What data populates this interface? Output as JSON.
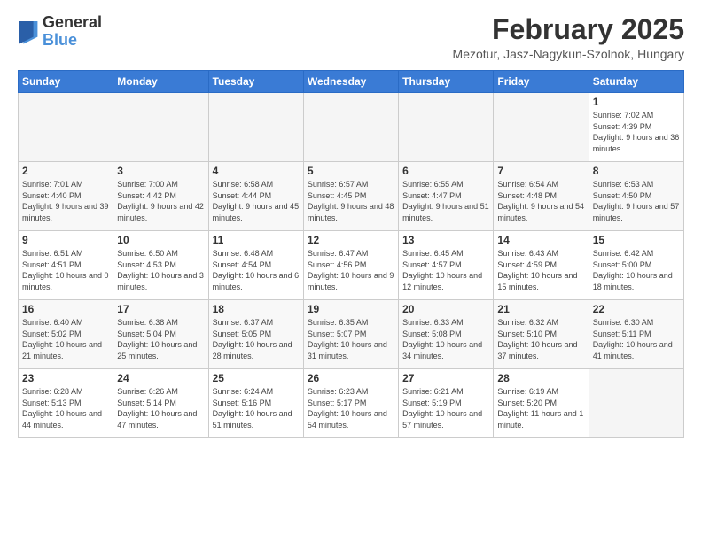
{
  "logo": {
    "general": "General",
    "blue": "Blue"
  },
  "title": "February 2025",
  "location": "Mezotur, Jasz-Nagykun-Szolnok, Hungary",
  "days_of_week": [
    "Sunday",
    "Monday",
    "Tuesday",
    "Wednesday",
    "Thursday",
    "Friday",
    "Saturday"
  ],
  "weeks": [
    [
      {
        "day": "",
        "info": ""
      },
      {
        "day": "",
        "info": ""
      },
      {
        "day": "",
        "info": ""
      },
      {
        "day": "",
        "info": ""
      },
      {
        "day": "",
        "info": ""
      },
      {
        "day": "",
        "info": ""
      },
      {
        "day": "1",
        "info": "Sunrise: 7:02 AM\nSunset: 4:39 PM\nDaylight: 9 hours and 36 minutes."
      }
    ],
    [
      {
        "day": "2",
        "info": "Sunrise: 7:01 AM\nSunset: 4:40 PM\nDaylight: 9 hours and 39 minutes."
      },
      {
        "day": "3",
        "info": "Sunrise: 7:00 AM\nSunset: 4:42 PM\nDaylight: 9 hours and 42 minutes."
      },
      {
        "day": "4",
        "info": "Sunrise: 6:58 AM\nSunset: 4:44 PM\nDaylight: 9 hours and 45 minutes."
      },
      {
        "day": "5",
        "info": "Sunrise: 6:57 AM\nSunset: 4:45 PM\nDaylight: 9 hours and 48 minutes."
      },
      {
        "day": "6",
        "info": "Sunrise: 6:55 AM\nSunset: 4:47 PM\nDaylight: 9 hours and 51 minutes."
      },
      {
        "day": "7",
        "info": "Sunrise: 6:54 AM\nSunset: 4:48 PM\nDaylight: 9 hours and 54 minutes."
      },
      {
        "day": "8",
        "info": "Sunrise: 6:53 AM\nSunset: 4:50 PM\nDaylight: 9 hours and 57 minutes."
      }
    ],
    [
      {
        "day": "9",
        "info": "Sunrise: 6:51 AM\nSunset: 4:51 PM\nDaylight: 10 hours and 0 minutes."
      },
      {
        "day": "10",
        "info": "Sunrise: 6:50 AM\nSunset: 4:53 PM\nDaylight: 10 hours and 3 minutes."
      },
      {
        "day": "11",
        "info": "Sunrise: 6:48 AM\nSunset: 4:54 PM\nDaylight: 10 hours and 6 minutes."
      },
      {
        "day": "12",
        "info": "Sunrise: 6:47 AM\nSunset: 4:56 PM\nDaylight: 10 hours and 9 minutes."
      },
      {
        "day": "13",
        "info": "Sunrise: 6:45 AM\nSunset: 4:57 PM\nDaylight: 10 hours and 12 minutes."
      },
      {
        "day": "14",
        "info": "Sunrise: 6:43 AM\nSunset: 4:59 PM\nDaylight: 10 hours and 15 minutes."
      },
      {
        "day": "15",
        "info": "Sunrise: 6:42 AM\nSunset: 5:00 PM\nDaylight: 10 hours and 18 minutes."
      }
    ],
    [
      {
        "day": "16",
        "info": "Sunrise: 6:40 AM\nSunset: 5:02 PM\nDaylight: 10 hours and 21 minutes."
      },
      {
        "day": "17",
        "info": "Sunrise: 6:38 AM\nSunset: 5:04 PM\nDaylight: 10 hours and 25 minutes."
      },
      {
        "day": "18",
        "info": "Sunrise: 6:37 AM\nSunset: 5:05 PM\nDaylight: 10 hours and 28 minutes."
      },
      {
        "day": "19",
        "info": "Sunrise: 6:35 AM\nSunset: 5:07 PM\nDaylight: 10 hours and 31 minutes."
      },
      {
        "day": "20",
        "info": "Sunrise: 6:33 AM\nSunset: 5:08 PM\nDaylight: 10 hours and 34 minutes."
      },
      {
        "day": "21",
        "info": "Sunrise: 6:32 AM\nSunset: 5:10 PM\nDaylight: 10 hours and 37 minutes."
      },
      {
        "day": "22",
        "info": "Sunrise: 6:30 AM\nSunset: 5:11 PM\nDaylight: 10 hours and 41 minutes."
      }
    ],
    [
      {
        "day": "23",
        "info": "Sunrise: 6:28 AM\nSunset: 5:13 PM\nDaylight: 10 hours and 44 minutes."
      },
      {
        "day": "24",
        "info": "Sunrise: 6:26 AM\nSunset: 5:14 PM\nDaylight: 10 hours and 47 minutes."
      },
      {
        "day": "25",
        "info": "Sunrise: 6:24 AM\nSunset: 5:16 PM\nDaylight: 10 hours and 51 minutes."
      },
      {
        "day": "26",
        "info": "Sunrise: 6:23 AM\nSunset: 5:17 PM\nDaylight: 10 hours and 54 minutes."
      },
      {
        "day": "27",
        "info": "Sunrise: 6:21 AM\nSunset: 5:19 PM\nDaylight: 10 hours and 57 minutes."
      },
      {
        "day": "28",
        "info": "Sunrise: 6:19 AM\nSunset: 5:20 PM\nDaylight: 11 hours and 1 minute."
      },
      {
        "day": "",
        "info": ""
      }
    ]
  ]
}
